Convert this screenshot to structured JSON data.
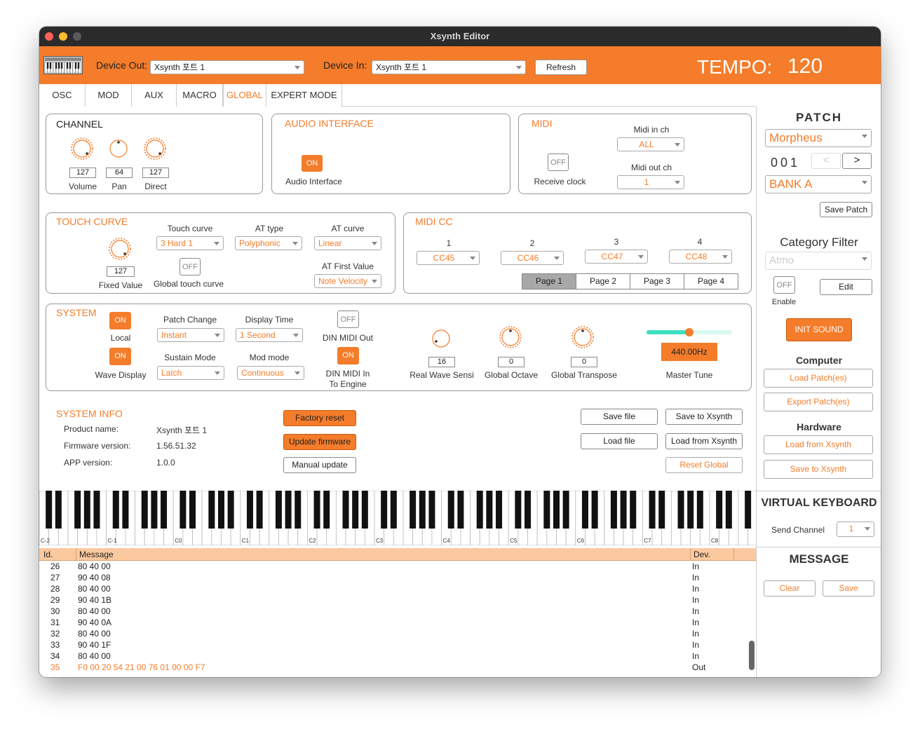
{
  "window": {
    "title": "Xsynth Editor"
  },
  "toolbar": {
    "device_out_label": "Device Out:",
    "device_out_value": "Xsynth 포트 1",
    "device_in_label": "Device In:",
    "device_in_value": "Xsynth 포트 1",
    "refresh_label": "Refresh",
    "tempo_label": "TEMPO:",
    "tempo_value": "120"
  },
  "tabs": [
    {
      "label": "OSC"
    },
    {
      "label": "MOD"
    },
    {
      "label": "AUX"
    },
    {
      "label": "MACRO"
    },
    {
      "label": "GLOBAL",
      "active": true
    },
    {
      "label": "EXPERT MODE"
    }
  ],
  "channel": {
    "title": "CHANNEL",
    "volume": {
      "value": "127",
      "label": "Volume"
    },
    "pan": {
      "value": "64",
      "label": "Pan"
    },
    "direct": {
      "value": "127",
      "label": "Direct"
    }
  },
  "audio_interface": {
    "title": "AUDIO  INTERFACE",
    "toggle": "ON",
    "label": "Audio Interface"
  },
  "midi": {
    "title": "MIDI",
    "receive_clock_toggle": "OFF",
    "receive_clock_label": "Receive clock",
    "midi_in_label": "Midi in ch",
    "midi_in_value": "ALL",
    "midi_out_label": "Midi out ch",
    "midi_out_value": "1"
  },
  "touch_curve": {
    "title": "TOUCH CURVE",
    "fixed_value": "127",
    "fixed_value_label": "Fixed Value",
    "touch_curve_label": "Touch curve",
    "touch_curve_value": "3 Hard 1",
    "global_touch_toggle": "OFF",
    "global_touch_label": "Global touch curve",
    "at_type_label": "AT  type",
    "at_type_value": "Polyphonic",
    "at_curve_label": "AT curve",
    "at_curve_value": "Linear",
    "at_first_label": "AT First Value",
    "at_first_value": "Note Velocity"
  },
  "midi_cc": {
    "title": "MIDI  CC",
    "slots": [
      {
        "num": "1",
        "value": "CC45"
      },
      {
        "num": "2",
        "value": "CC46"
      },
      {
        "num": "3",
        "value": "CC47"
      },
      {
        "num": "4",
        "value": "CC48"
      }
    ],
    "pages": [
      "Page  1",
      "Page  2",
      "Page  3",
      "Page  4"
    ]
  },
  "system": {
    "title": "SYSTEM",
    "local_toggle": "ON",
    "local_label": "Local",
    "wave_toggle": "ON",
    "wave_label": "Wave Display",
    "patch_change_label": "Patch Change",
    "patch_change_value": "Instant",
    "display_time_label": "Display Time",
    "display_time_value": "1 Second",
    "sustain_label": "Sustain Mode",
    "sustain_value": "Latch",
    "mod_mode_label": "Mod mode",
    "mod_mode_value": "Continuous",
    "din_out_toggle": "OFF",
    "din_out_label": "DIN MIDI Out",
    "din_in_toggle": "ON",
    "din_in_label_1": "DIN MIDI In",
    "din_in_label_2": "To Engine",
    "real_wave_value": "16",
    "real_wave_label": "Real Wave Sensi",
    "global_octave_value": "0",
    "global_octave_label": "Global Octave",
    "global_transpose_value": "0",
    "global_transpose_label": "Global Transpose",
    "master_tune_value": "440.00Hz",
    "master_tune_label": "Master Tune",
    "master_tune_level": 0.5
  },
  "system_info": {
    "title": "SYSTEM  INFO",
    "product_label": "Product name:",
    "product_value": "Xsynth 포트 1",
    "firmware_label": "Firmware version:",
    "firmware_value": "1.56.51.32",
    "app_label": "APP version:",
    "app_value": "1.0.0",
    "factory_reset": "Factory reset",
    "update_firmware": "Update firmware",
    "manual_update": "Manual update",
    "save_file": "Save file",
    "save_to_xsynth": "Save to Xsynth",
    "load_file": "Load file",
    "load_from_xsynth": "Load from Xsynth",
    "reset_global": "Reset Global"
  },
  "keyboard": {
    "octave_labels": [
      "C-2",
      "C-1",
      "C0",
      "C1",
      "C2",
      "C3",
      "C4",
      "C5",
      "C6",
      "C7",
      "C8"
    ]
  },
  "messages": {
    "headers": {
      "id": "Id.",
      "message": "Message",
      "dev": "Dev."
    },
    "rows": [
      {
        "id": "26",
        "msg": "80 40 00",
        "dev": "In"
      },
      {
        "id": "27",
        "msg": "90 40 08",
        "dev": "In"
      },
      {
        "id": "28",
        "msg": "80 40 00",
        "dev": "In"
      },
      {
        "id": "29",
        "msg": "90 40 1B",
        "dev": "In"
      },
      {
        "id": "30",
        "msg": "80 40 00",
        "dev": "In"
      },
      {
        "id": "31",
        "msg": "90 40 0A",
        "dev": "In"
      },
      {
        "id": "32",
        "msg": "80 40 00",
        "dev": "In"
      },
      {
        "id": "33",
        "msg": "90 40 1F",
        "dev": "In"
      },
      {
        "id": "34",
        "msg": "80 40 00",
        "dev": "In"
      },
      {
        "id": "35",
        "msg": "F0 00 20 54 21 00 76 01 00 00 F7",
        "dev": "Out",
        "highlight": true
      }
    ]
  },
  "patch": {
    "title": "PATCH",
    "name": "Morpheus",
    "number": "001",
    "prev": "<",
    "next": ">",
    "bank": "BANK A",
    "save_patch": "Save Patch",
    "category_title": "Category Filter",
    "category_value": "Atmo",
    "enable_toggle": "OFF",
    "enable_label": "Enable",
    "edit": "Edit",
    "init_sound": "INIT  SOUND",
    "computer_title": "Computer",
    "load_patches": "Load Patch(es)",
    "export_patches": "Export Patch(es)",
    "hardware_title": "Hardware",
    "load_from_xsynth": "Load from Xsynth",
    "save_to_xsynth": "Save to Xsynth"
  },
  "virtual_keyboard": {
    "title": "VIRTUAL KEYBOARD",
    "send_channel_label": "Send Channel",
    "send_channel_value": "1"
  },
  "message_panel": {
    "title": "MESSAGE",
    "clear": "Clear",
    "save": "Save"
  },
  "colors": {
    "accent": "#f47c2a",
    "toolbar": "#f47c2a",
    "titlebar": "#2b2b2b",
    "header_row": "#fbc99f",
    "slider_track": "#3fe0c0"
  }
}
